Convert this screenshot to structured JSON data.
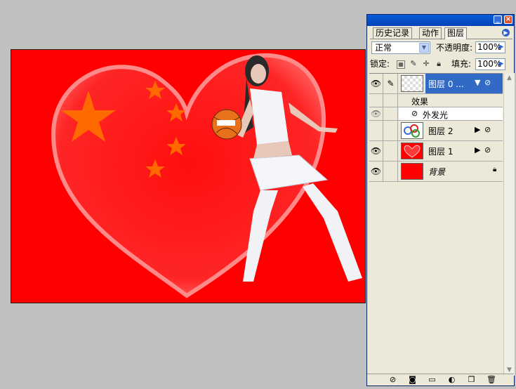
{
  "panel": {
    "tabs": [
      "历史记录",
      "动作",
      "图层"
    ],
    "blend_mode": "正常",
    "opacity_label": "不透明度:",
    "opacity_value": "100%",
    "lock_label": "锁定:",
    "fill_label": "填充:",
    "fill_value": "100%"
  },
  "layers": [
    {
      "name": "图层 0 ...",
      "selected": true,
      "has_effects": true,
      "effects_label": "效果",
      "effects": [
        "外发光"
      ]
    },
    {
      "name": "图层 2",
      "selected": false
    },
    {
      "name": "图层 1",
      "selected": false
    },
    {
      "name": "背景",
      "selected": false,
      "locked": true
    }
  ],
  "colors": {
    "canvas_red": "#ff0000",
    "star_orange": "#ff6a00",
    "selection_blue": "#316ac5",
    "titlebar_blue": "#0a5cd8"
  },
  "icons": {
    "eye": "eye-icon",
    "brush": "brush-icon",
    "lock": "lock-icon",
    "fx": "fx-icon"
  }
}
